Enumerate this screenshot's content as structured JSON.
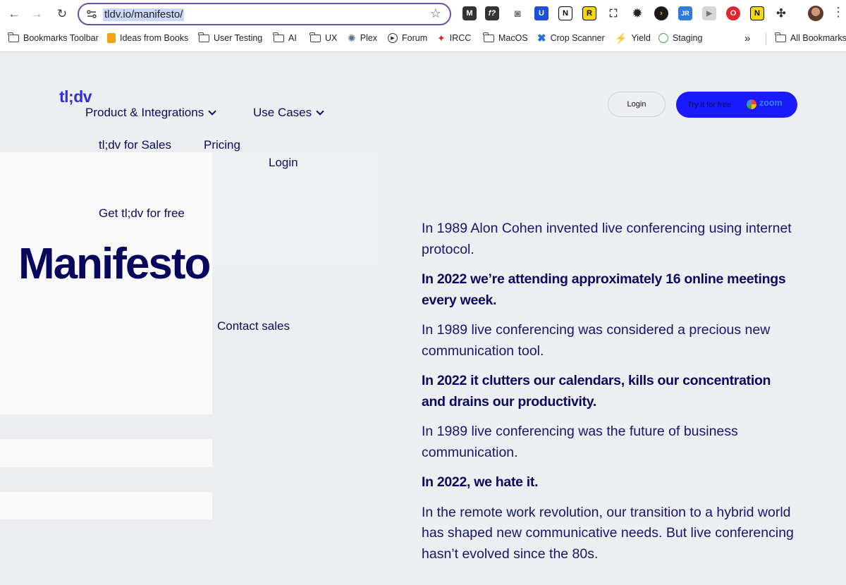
{
  "browser": {
    "url": "tldv.io/manifesto/",
    "nav": {
      "back": "←",
      "forward": "→",
      "reload": "↻"
    },
    "extensions": [
      "M",
      "f?",
      "camera-icon",
      "U",
      "N",
      "R",
      "screenshot-icon",
      "settings-icon",
      "play-icon",
      "JR",
      "video-icon",
      "O",
      "N",
      "puzzle-icon"
    ],
    "bookmarks": [
      {
        "label": "Bookmarks Toolbar",
        "icon": "folder-icon"
      },
      {
        "label": "Ideas from Books",
        "icon": "bookmark-icon"
      },
      {
        "label": "User Testing",
        "icon": "folder-icon"
      },
      {
        "label": "AI",
        "icon": "folder-icon"
      },
      {
        "label": "UX",
        "icon": "folder-icon"
      },
      {
        "label": "Plex",
        "icon": "gear-icon"
      },
      {
        "label": "Forum",
        "icon": "play-icon"
      },
      {
        "label": "IRCC",
        "icon": "maple-leaf-icon"
      },
      {
        "label": "MacOS",
        "icon": "folder-icon"
      },
      {
        "label": "Crop Scanner",
        "icon": "crop-icon"
      },
      {
        "label": "Yield",
        "icon": "yield-icon"
      },
      {
        "label": "Staging",
        "icon": "globe-icon"
      }
    ],
    "more_bookmarks": "»",
    "all_bookmarks": "All Bookmarks"
  },
  "site": {
    "logo": "tl;dv",
    "nav": {
      "product": "Product & Integrations",
      "use_cases": "Use Cases",
      "sales": "tl;dv for Sales",
      "pricing": "Pricing",
      "login": "Login",
      "get_free": "Get tl;dv for free",
      "contact_sales": "Contact sales"
    },
    "login_button": "Login",
    "try_button": "Try it for free",
    "try_zoom": "zoom",
    "headline": "Manifesto",
    "manifesto": [
      {
        "text": "In 1989 Alon Cohen invented live conferencing using internet protocol.",
        "bold": false
      },
      {
        "text": "In 2022 we’re attending approximately 16 online meetings every week.",
        "bold": true
      },
      {
        "text": "In 1989 live conferencing was considered a precious new communication tool.",
        "bold": false
      },
      {
        "text": "In 2022 it clutters our calendars, kills our concentration and drains our productivity.",
        "bold": true
      },
      {
        "text": "In 1989 live conferencing was the future of business communication.",
        "bold": false
      },
      {
        "text": "In 2022, we hate it.",
        "bold": true
      },
      {
        "text": "In the remote work revolution, our transition to a hybrid world has shaped new communicative needs. But live conferencing hasn’t evolved since the 80s.",
        "bold": false
      }
    ]
  },
  "colors": {
    "brand_blue": "#1a1aff",
    "logo_blue": "#2f2fd9",
    "navy_text": "#0b0b5c",
    "page_bg": "#eceef2"
  }
}
